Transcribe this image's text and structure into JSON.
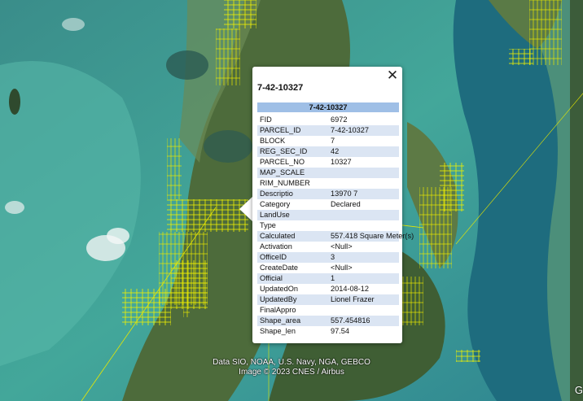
{
  "popup": {
    "title": "7-42-10327",
    "table_header": "7-42-10327",
    "close_glyph": "✕",
    "rows": [
      {
        "key": "FID",
        "value": "6972"
      },
      {
        "key": "PARCEL_ID",
        "value": "7-42-10327"
      },
      {
        "key": "BLOCK",
        "value": "7"
      },
      {
        "key": "REG_SEC_ID",
        "value": "42"
      },
      {
        "key": "PARCEL_NO",
        "value": "10327"
      },
      {
        "key": "MAP_SCALE",
        "value": ""
      },
      {
        "key": "RIM_NUMBER",
        "value": ""
      },
      {
        "key": "Descriptio",
        "value": "13970 7"
      },
      {
        "key": "Category",
        "value": "Declared"
      },
      {
        "key": "LandUse",
        "value": ""
      },
      {
        "key": "Type",
        "value": ""
      },
      {
        "key": "Calculated",
        "value": "557.418 Square Meter(s)"
      },
      {
        "key": "Activation",
        "value": "<Null>"
      },
      {
        "key": "OfficeID",
        "value": "3"
      },
      {
        "key": "CreateDate",
        "value": "<Null>"
      },
      {
        "key": "Official",
        "value": "1"
      },
      {
        "key": "UpdatedOn",
        "value": "2014-08-12"
      },
      {
        "key": "UpdatedBy",
        "value": "Lionel Frazer"
      },
      {
        "key": "FinalAppro",
        "value": ""
      },
      {
        "key": "Shape_area",
        "value": "557.454816"
      },
      {
        "key": "Shape_len",
        "value": "97.54"
      }
    ]
  },
  "map": {
    "credit_line1": "Data SIO, NOAA, U.S. Navy, NGA, GEBCO",
    "credit_line2": "Image © 2023 CNES / Airbus",
    "corner_text": "G",
    "colors": {
      "sea_shallow": "#3d9c92",
      "sea_deep": "#1d5e74",
      "land": "#4f6a3a",
      "parcel": "#f0f000"
    }
  }
}
